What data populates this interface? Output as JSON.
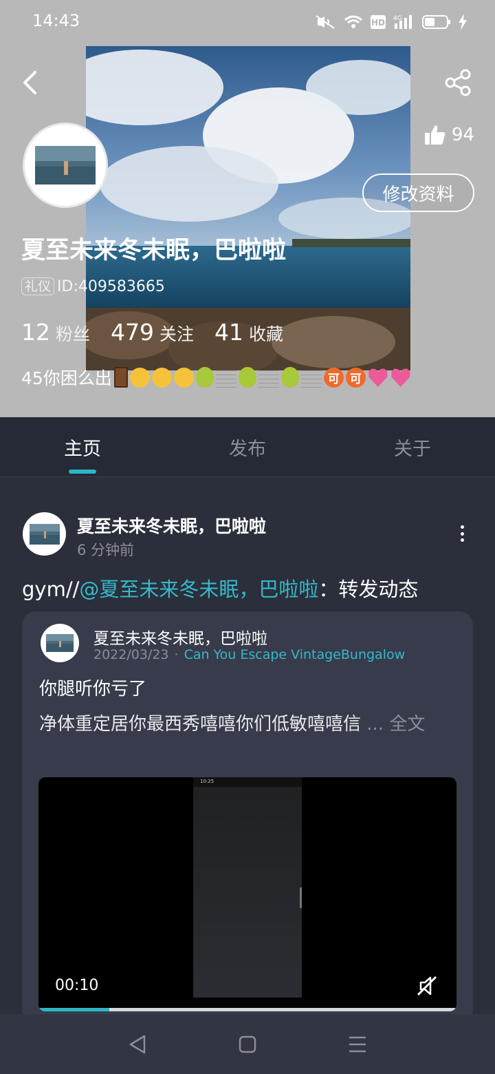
{
  "status_bar": {
    "time": "14:43",
    "icons": [
      "mute-icon",
      "wifi-icon",
      "hd-icon",
      "4g-signal-icon",
      "battery-icon",
      "charging-icon"
    ]
  },
  "header": {
    "like_count": "94",
    "edit_profile_label": "修改资料",
    "user_name": "夏至未来冬未眠，巴啦啦",
    "badge_label": "礼仪",
    "user_id": "ID:409583665",
    "stats": [
      {
        "value": "12",
        "label": "粉丝"
      },
      {
        "value": "479",
        "label": "关注"
      },
      {
        "value": "41",
        "label": "收藏"
      }
    ],
    "bio_text": "45你困么出",
    "bio_emojis": [
      "door",
      "mask-face",
      "tongue-face",
      "crying-face",
      "pear",
      "clef",
      "pear",
      "clef",
      "pear",
      "clef",
      "ke",
      "ke",
      "heart",
      "heart"
    ],
    "ke_char": "可"
  },
  "tabs": [
    {
      "label": "主页",
      "active": true
    },
    {
      "label": "发布",
      "active": false
    },
    {
      "label": "关于",
      "active": false
    }
  ],
  "post": {
    "author": "夏至未来冬未眠，巴啦啦",
    "time": "6 分钟前",
    "text_prefix": "gym//",
    "mention": "@夏至未来冬未眠，巴啦啦",
    "text_suffix": "：转发动态",
    "repost": {
      "author": "夏至未来冬未眠，巴啦啦",
      "date": "2022/03/23",
      "separator": "·",
      "game": "Can You Escape VintageBungalow",
      "line1": "你腿听你亏了",
      "line2": "净体重定居你最西秀嘻嘻你们低敏嘻嘻信",
      "more_label": "... 全文",
      "video": {
        "inner_time": "10:25",
        "duration": "00:10",
        "progress": 0.17
      }
    }
  },
  "colors": {
    "accent": "#2ab7c8",
    "background": "#2b2e3b",
    "header_bg": "#b8b8b9"
  }
}
